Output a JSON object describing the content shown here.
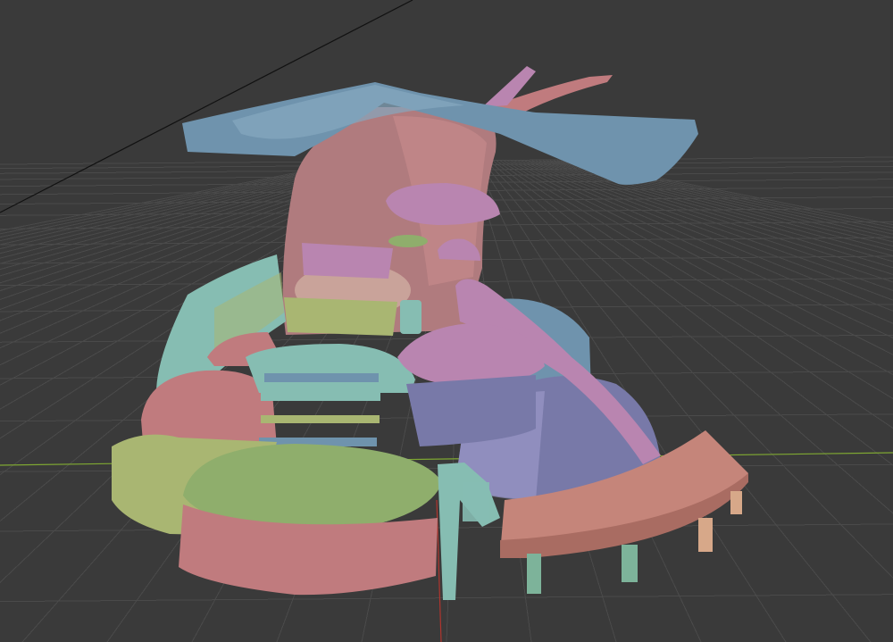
{
  "viewport": {
    "background": "#3a3a3a",
    "grid_color": "#4a4a4a",
    "x_axis_color": "#7fa832",
    "z_axis_color": "#b0352e",
    "camera_line_color": "#111111"
  },
  "model": {
    "palette": {
      "canopy": "#6f93ad",
      "trunk": "#b07b7e",
      "mauve": "#b985b0",
      "teal": "#86bdb2",
      "olive": "#a9b672",
      "green": "#8fae6c",
      "rose": "#c07b7e",
      "periwinkle": "#7879a8",
      "deck": "#c5857a",
      "post_teal": "#7db39a",
      "post_tan": "#d7a889",
      "lavender": "#9a97c8"
    }
  }
}
